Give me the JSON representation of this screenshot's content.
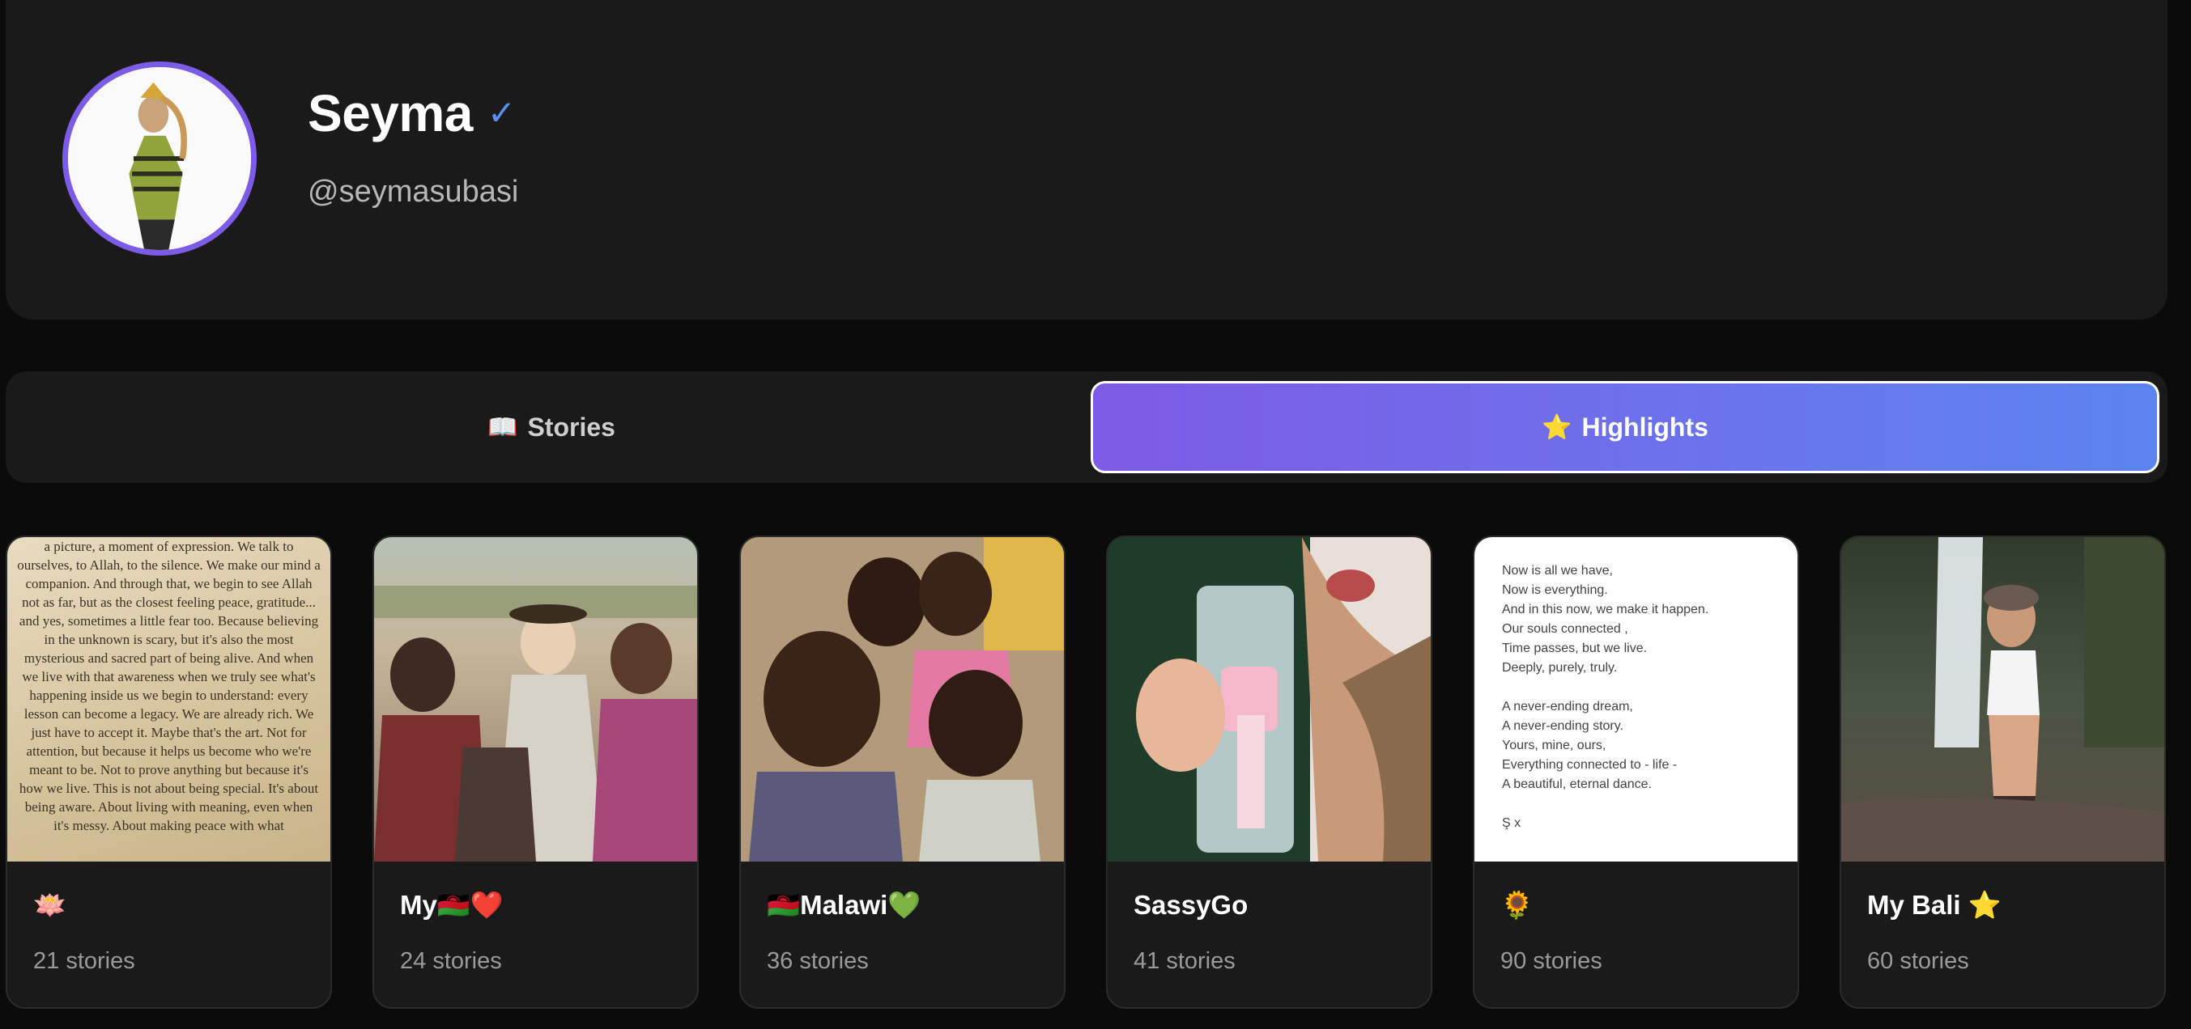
{
  "profile": {
    "name": "Seyma",
    "verified_mark": "✓",
    "handle": "@seymasubasi"
  },
  "tabs": [
    {
      "icon": "📖",
      "label": "Stories",
      "active": false
    },
    {
      "icon": "⭐",
      "label": "Highlights",
      "active": true
    }
  ],
  "highlights": [
    {
      "title": "🪷",
      "count": "21 stories"
    },
    {
      "title": "My🇲🇼❤️",
      "count": "24 stories"
    },
    {
      "title": "🇲🇼Malawi💚",
      "count": "36 stories"
    },
    {
      "title": "SassyGo",
      "count": "41 stories"
    },
    {
      "title": "🌻",
      "count": "90 stories"
    },
    {
      "title": "My Bali ⭐",
      "count": "60 stories"
    }
  ],
  "thumb_text_1": "a picture, a moment of expression. We talk to ourselves, to Allah, to the silence. We make our mind a companion. And through that, we begin to see Allah not as far, but as the closest feeling peace, gratitude... and yes, sometimes a little fear too. Because believing in the unknown is scary, but it's also the most mysterious and sacred part of being alive. And when we live with that awareness when we truly see what's happening inside us we begin to understand: every lesson can become a legacy. We are already rich. We just have to accept it. Maybe that's the art. Not for attention, but because it helps us become who we're meant to be. Not to prove anything but because it's how we live. This is not about being special. It's about being aware. About living with meaning, even when it's messy. About making peace with what",
  "thumb_poem_5": [
    "Now is all we have,",
    "Now is everything.",
    "And in this now, we make it happen.",
    "Our souls connected ,",
    "Time passes, but we live.",
    "Deeply, purely, truly.",
    "",
    "A never-ending dream,",
    "A never-ending story.",
    "Yours, mine, ours,",
    "Everything connected to - life -",
    "A beautiful, eternal dance.",
    "",
    "Ş x"
  ],
  "colors": {
    "background": "#0b0b0b",
    "card": "#1a1a1a",
    "accent_start": "#7e5be6",
    "accent_end": "#5c84ef",
    "avatar_ring": "#7c5ce6",
    "verified": "#5b8df0"
  }
}
